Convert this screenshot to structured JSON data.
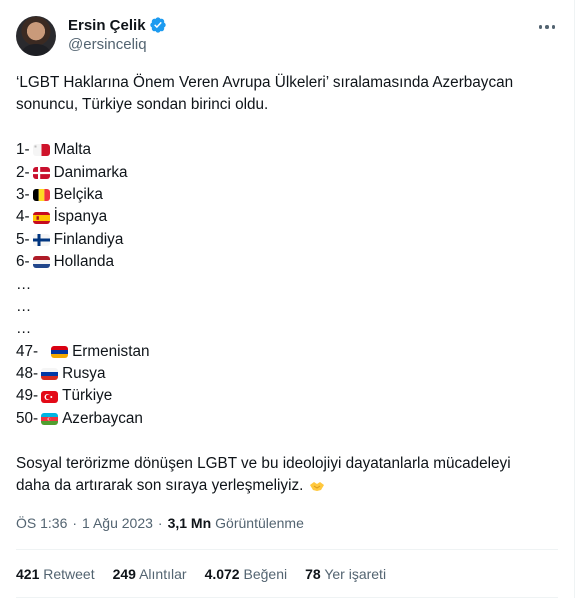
{
  "author": {
    "name": "Ersin Çelik",
    "handle": "@ersinceliq",
    "verified": true
  },
  "tweet": {
    "intro_line1": "‘LGBT Haklarına Önem Veren Avrupa Ülkeleri’ sıralamasında Azerbaycan",
    "intro_line2": "sonuncu, Türkiye sondan birinci oldu.",
    "ranking": [
      {
        "rank": "1-",
        "flag": "malta",
        "country": "Malta"
      },
      {
        "rank": "2-",
        "flag": "denmark",
        "country": "Danimarka"
      },
      {
        "rank": "3-",
        "flag": "belgium",
        "country": "Belçika"
      },
      {
        "rank": "4-",
        "flag": "spain",
        "country": "İspanya"
      },
      {
        "rank": "5-",
        "flag": "finland",
        "country": "Finlandiya"
      },
      {
        "rank": "6-",
        "flag": "netherlands",
        "country": "Hollanda"
      }
    ],
    "ellipsis": [
      "…",
      "…",
      "…"
    ],
    "ranking_bottom": [
      {
        "rank": "47-",
        "flag": "armenia",
        "country": "Ermenistan"
      },
      {
        "rank": "48-",
        "flag": "russia",
        "country": "Rusya"
      },
      {
        "rank": "49-",
        "flag": "turkey",
        "country": "Türkiye"
      },
      {
        "rank": "50-",
        "flag": "azerbaijan",
        "country": "Azerbaycan"
      }
    ],
    "outro_line1": "Sosyal terörizme dönüşen LGBT ve bu ideolojiyi dayatanlarla mücadeleyi",
    "outro_line2": "daha da artırarak son sıraya yerleşmeliyiz.",
    "outro_emoji": "handshake-emoji"
  },
  "meta": {
    "time": "ÖS 1:36",
    "date": "1 Ağu 2023",
    "separator": "·",
    "views_count": "3,1 Mn",
    "views_label": "Görüntülenme"
  },
  "stats": [
    {
      "count": "421",
      "label": "Retweet"
    },
    {
      "count": "249",
      "label": "Alıntılar"
    },
    {
      "count": "4.072",
      "label": "Beğeni"
    },
    {
      "count": "78",
      "label": "Yer işareti"
    }
  ],
  "colors": {
    "text": "#0f1419",
    "muted": "#536471",
    "verified": "#1d9bf0",
    "divider": "#eff3f4"
  }
}
